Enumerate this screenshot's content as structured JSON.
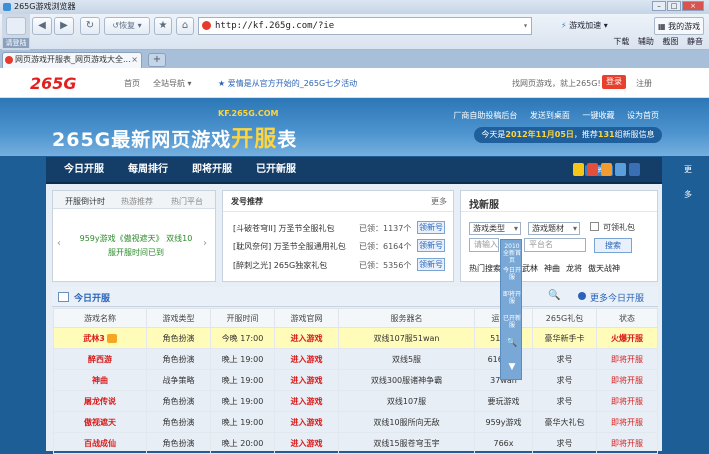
{
  "window": {
    "title": "265G游戏浏览器"
  },
  "toolbar": {
    "login_label": "请登陆",
    "back": "◀",
    "forward": "▶",
    "refresh": "↻",
    "restore_label": "恢复",
    "address": "http://kf.265g.com/?ie",
    "game_accel": "游戏加速",
    "my_games": "我的游戏",
    "row2": [
      "下载",
      "辅助",
      "截图",
      "静音"
    ]
  },
  "tabs": [
    {
      "label": "网页游戏开服表_网页游戏大全..."
    }
  ],
  "site": {
    "logo": "265G",
    "nav": [
      "首页",
      "全站导航"
    ],
    "promo": "爱情是从官方开始的_265G七夕活动",
    "find": "找网页游戏，就上265G!",
    "login": "登录",
    "register": "注册"
  },
  "banner": {
    "url": "KF.265G.COM",
    "title_main": "265G最新网页游戏",
    "title_hl": "开服",
    "title_end": "表",
    "links": [
      "厂商自助投稿后台",
      "发送到桌面",
      "一键收藏",
      "设为首页"
    ],
    "date_prefix": "今天是",
    "date": "2012年11月05日",
    "date_mid": "，推荐",
    "count": "131",
    "date_suffix": "组新服信息"
  },
  "mainnav": {
    "items": [
      "今日开服",
      "每周排行",
      "即将开服",
      "已开新服"
    ],
    "share": "分享到",
    "more": "更多"
  },
  "panel_left": {
    "tabs": [
      "开服倒计时",
      "热游推荐",
      "热门平台"
    ],
    "text": "959y游戏《傲视遮天》 双线10服开服时间已到"
  },
  "gifts": {
    "title": "发号推荐",
    "more": "更多",
    "items": [
      {
        "name": "[斗破苍穹II] 万圣节全服礼包",
        "count": "已领：1137个",
        "btn": "领新号"
      },
      {
        "name": "[耽风奈何] 万圣节全服通用礼包",
        "count": "已领：6164个",
        "btn": "领新号"
      },
      {
        "name": "[醉刺之光] 265G独家礼包",
        "count": "已领：5356个",
        "btn": "领新号"
      }
    ]
  },
  "search": {
    "title": "找新服",
    "type_sel": "游戏类型",
    "theme_sel": "游戏题材",
    "gift_chk": "可领礼包",
    "placeholder": "请输入",
    "placeholder2": "平台名",
    "btn": "搜索",
    "quick": [
      "热门搜索",
      "武林",
      "神曲",
      "龙将",
      "傲天战神"
    ]
  },
  "float_bar": [
    "2010全新首页",
    "今日开服",
    "即将开服",
    "已开新服",
    "🔍",
    "▼"
  ],
  "today": {
    "title": "今日开服",
    "more": "更多今日开服",
    "headers": [
      "游戏名称",
      "游戏类型",
      "开服时间",
      "游戏官网",
      "服务器名",
      "运营商",
      "265G礼包",
      "状态"
    ],
    "rows": [
      {
        "name": "武林3",
        "type": "角色扮演",
        "time": "今晚 17:00",
        "site": "进入游戏",
        "server": "双线107服51wan",
        "op": "51wan",
        "gift": "豪华新手卡",
        "status": "火爆开服",
        "hl": true
      },
      {
        "name": "醉西游",
        "type": "角色扮演",
        "time": "晚上 19:00",
        "site": "进入游戏",
        "server": "双线5服",
        "op": "616wan",
        "gift": "求号",
        "status": "即将开服",
        "hl": false
      },
      {
        "name": "神曲",
        "type": "战争策略",
        "time": "晚上 19:00",
        "site": "进入游戏",
        "server": "双线300服诸神争霸",
        "op": "37wan",
        "gift": "求号",
        "status": "即将开服",
        "hl": false
      },
      {
        "name": "屠龙传说",
        "type": "角色扮演",
        "time": "晚上 19:00",
        "site": "进入游戏",
        "server": "双线107服",
        "op": "要玩游戏",
        "gift": "求号",
        "status": "即将开服",
        "hl": false
      },
      {
        "name": "傲视遮天",
        "type": "角色扮演",
        "time": "晚上 19:00",
        "site": "进入游戏",
        "server": "双线10服所向无敌",
        "op": "959y游戏",
        "gift": "豪华大礼包",
        "status": "即将开服",
        "hl": false
      },
      {
        "name": "百战成仙",
        "type": "角色扮演",
        "time": "晚上 20:00",
        "site": "进入游戏",
        "server": "双线15服苍穹玉宇",
        "op": "766x",
        "gift": "求号",
        "status": "即将开服",
        "hl": false
      }
    ]
  }
}
